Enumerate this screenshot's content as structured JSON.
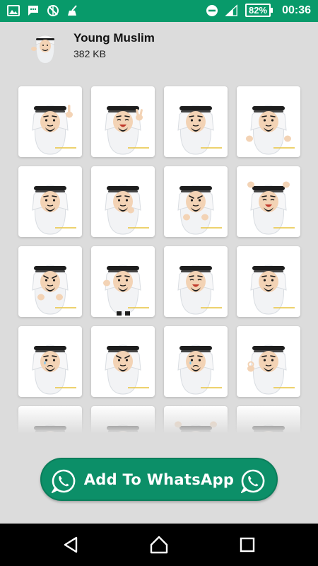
{
  "status_bar": {
    "icons_left": [
      "image-icon",
      "message-icon",
      "no-sync-icon",
      "cleaner-icon"
    ],
    "icons_right": [
      "do-not-disturb-icon",
      "signal-icon",
      "battery-icon"
    ],
    "battery_percent": "82%",
    "time": "00:36"
  },
  "pack": {
    "title": "Young Muslim",
    "size": "382 KB",
    "tray_icon": "sticker-character-icon"
  },
  "stickers": [
    {
      "name": "sticker-thumbs-point",
      "pose": "point-up"
    },
    {
      "name": "sticker-peace",
      "pose": "peace"
    },
    {
      "name": "sticker-neutral",
      "pose": "neutral"
    },
    {
      "name": "sticker-shrug",
      "pose": "shrug"
    },
    {
      "name": "sticker-cover-eyes",
      "pose": "neutral"
    },
    {
      "name": "sticker-thinking",
      "pose": "thinking"
    },
    {
      "name": "sticker-angry-fists",
      "pose": "angry"
    },
    {
      "name": "sticker-cheer",
      "pose": "cheer"
    },
    {
      "name": "sticker-angry-stop",
      "pose": "angry"
    },
    {
      "name": "sticker-full-body",
      "pose": "standing"
    },
    {
      "name": "sticker-laugh",
      "pose": "laugh"
    },
    {
      "name": "sticker-hand-raise",
      "pose": "neutral"
    },
    {
      "name": "sticker-sad",
      "pose": "sad"
    },
    {
      "name": "sticker-serious",
      "pose": "serious"
    },
    {
      "name": "sticker-crying",
      "pose": "sad"
    },
    {
      "name": "sticker-ok",
      "pose": "ok"
    },
    {
      "name": "sticker-partial-1",
      "pose": "neutral"
    },
    {
      "name": "sticker-partial-2",
      "pose": "neutral"
    },
    {
      "name": "sticker-partial-3",
      "pose": "cheer"
    },
    {
      "name": "sticker-partial-4",
      "pose": "neutral"
    }
  ],
  "add_button": {
    "label": "Add To WhatsApp",
    "icon": "whatsapp-icon",
    "color": "#0c8f68"
  },
  "nav": {
    "back": "back-icon",
    "home": "home-icon",
    "recent": "recent-apps-icon"
  },
  "colors": {
    "status_bar": "#089a6a",
    "background": "#dcdcdc"
  }
}
